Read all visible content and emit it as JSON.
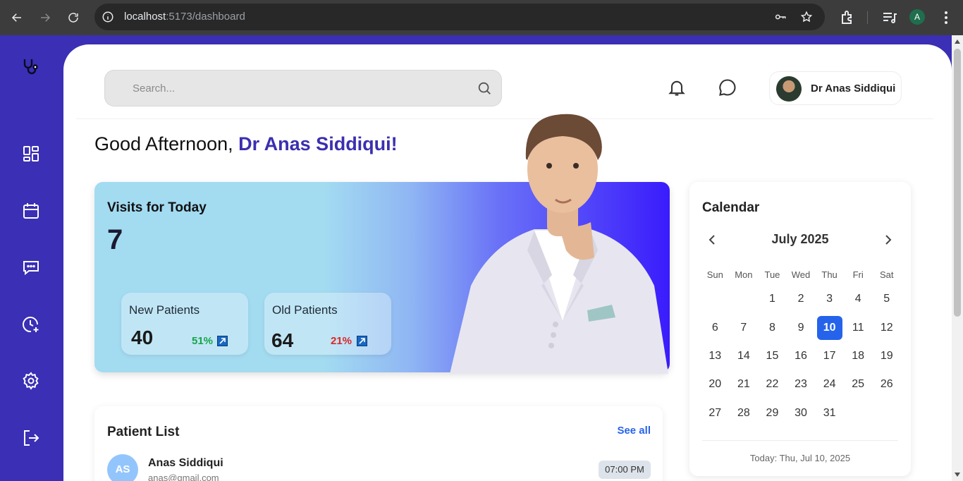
{
  "browser": {
    "url_host": "localhost",
    "url_rest": ":5173/dashboard",
    "profile_initial": "A"
  },
  "colors": {
    "sidebar": "#3a2fb5",
    "accent": "#3b2fb0",
    "today": "#2563eb",
    "positive": "#16a34a",
    "negative": "#dc2626"
  },
  "sidebar": {
    "items": [
      {
        "name": "dashboard",
        "icon": "grid-icon"
      },
      {
        "name": "calendar",
        "icon": "calendar-icon"
      },
      {
        "name": "messages",
        "icon": "message-icon"
      },
      {
        "name": "history",
        "icon": "clock-plus-icon"
      },
      {
        "name": "settings",
        "icon": "gear-icon"
      },
      {
        "name": "logout",
        "icon": "logout-icon"
      }
    ]
  },
  "header": {
    "search_placeholder": "Search...",
    "user_name": "Dr Anas Siddiqui"
  },
  "greeting": {
    "prefix": "Good Afternoon, ",
    "name": "Dr Anas Siddiqui!"
  },
  "visits": {
    "title": "Visits for Today",
    "total": "7",
    "new": {
      "label": "New Patients",
      "value": "40",
      "percent": "51%"
    },
    "old": {
      "label": "Old Patients",
      "value": "64",
      "percent": "21%"
    }
  },
  "calendar": {
    "title": "Calendar",
    "month": "July 2025",
    "weekdays": [
      "Sun",
      "Mon",
      "Tue",
      "Wed",
      "Thu",
      "Fri",
      "Sat"
    ],
    "weeks": [
      [
        "",
        "",
        "1",
        "2",
        "3",
        "4",
        "5"
      ],
      [
        "6",
        "7",
        "8",
        "9",
        "10",
        "11",
        "12"
      ],
      [
        "13",
        "14",
        "15",
        "16",
        "17",
        "18",
        "19"
      ],
      [
        "20",
        "21",
        "22",
        "23",
        "24",
        "25",
        "26"
      ],
      [
        "27",
        "28",
        "29",
        "30",
        "31",
        "",
        ""
      ]
    ],
    "selected": "10",
    "today_label": "Today: Thu, Jul 10, 2025"
  },
  "patients": {
    "title": "Patient List",
    "see_all": "See all",
    "rows": [
      {
        "initials": "AS",
        "name": "Anas Siddiqui",
        "email": "anas@gmail.com",
        "time": "07:00 PM"
      }
    ]
  }
}
